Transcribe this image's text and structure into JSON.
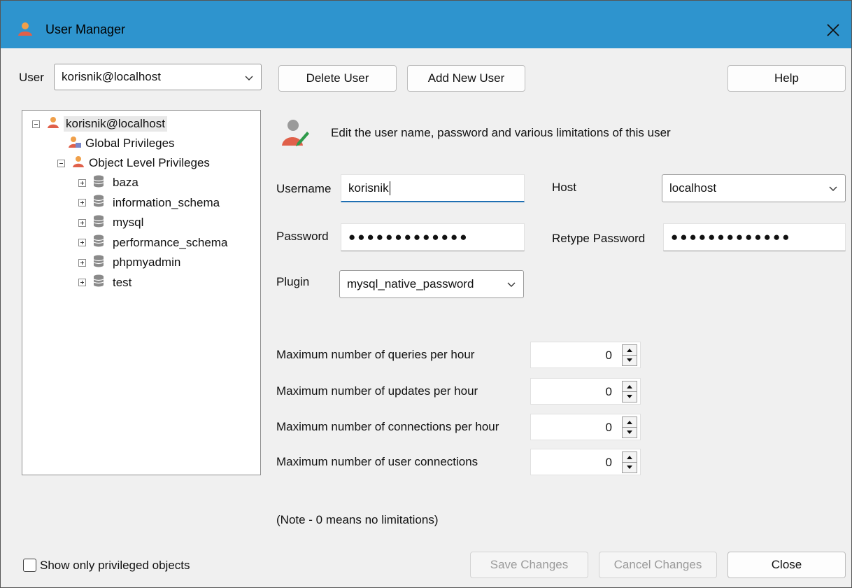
{
  "window": {
    "title": "User Manager",
    "titlebar_color": "#2e94ce",
    "close_icon": "close-icon"
  },
  "user_selector": {
    "label": "User",
    "value": "korisnik@localhost"
  },
  "toolbar": {
    "delete_label": "Delete User",
    "add_label": "Add New User",
    "help_label": "Help"
  },
  "tree": {
    "root": "korisnik@localhost",
    "global": "Global Privileges",
    "object_level": "Object Level Privileges",
    "databases": [
      "baza",
      "information_schema",
      "mysql",
      "performance_schema",
      "phpmyadmin",
      "test"
    ]
  },
  "form": {
    "description": "Edit the user name, password and various limitations of this user",
    "username_label": "Username",
    "username_value": "korisnik",
    "host_label": "Host",
    "host_value": "localhost",
    "password_label": "Password",
    "password_value": "●●●●●●●●●●●●●",
    "retype_label": "Retype Password",
    "retype_value": "●●●●●●●●●●●●●",
    "plugin_label": "Plugin",
    "plugin_value": "mysql_native_password"
  },
  "limits": {
    "items": [
      {
        "label": "Maximum number of queries per hour",
        "value": "0"
      },
      {
        "label": "Maximum number of updates per hour",
        "value": "0"
      },
      {
        "label": "Maximum number of connections per hour",
        "value": "0"
      },
      {
        "label": "Maximum number of user connections",
        "value": "0"
      }
    ],
    "note": "(Note - 0 means no limitations)"
  },
  "footer": {
    "show_privileged_label": "Show only privileged objects",
    "show_privileged_checked": false,
    "save_label": "Save Changes",
    "cancel_label": "Cancel Changes",
    "close_label": "Close"
  },
  "colors": {
    "accent": "#1f6fb2",
    "user_icon": "#e0604a",
    "db_icon": "#8a8a8a"
  }
}
